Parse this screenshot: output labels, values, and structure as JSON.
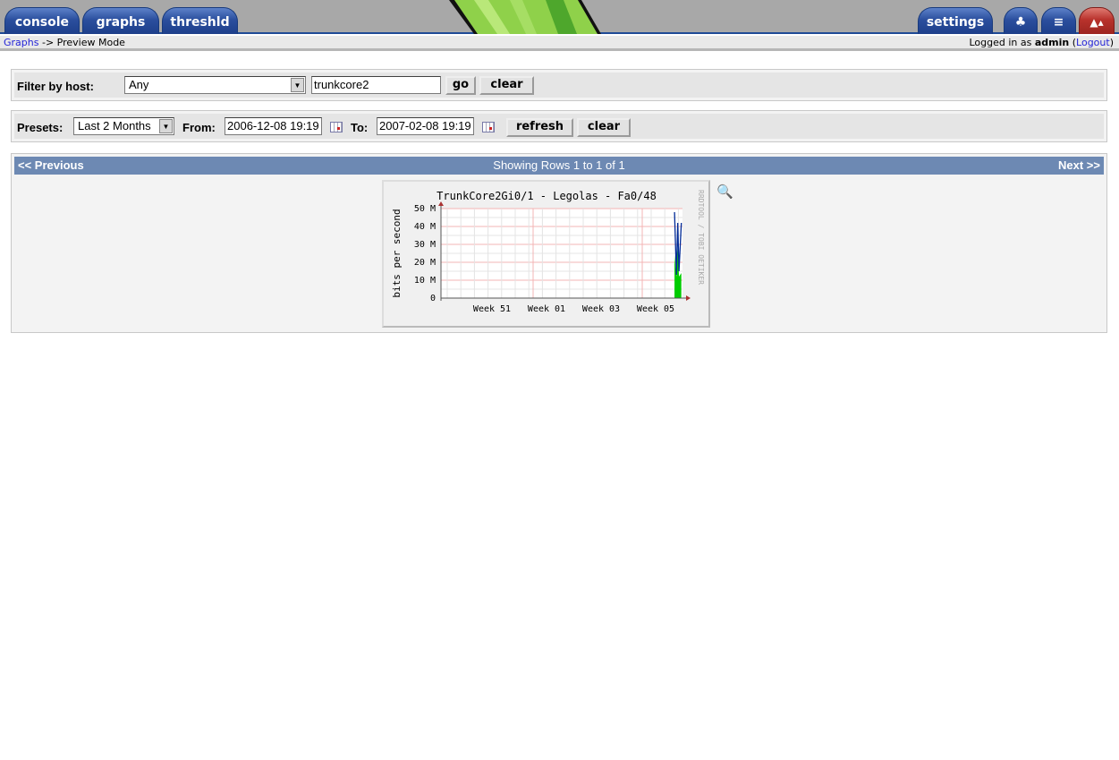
{
  "nav": {
    "tabs_left": [
      "console",
      "graphs",
      "threshld"
    ],
    "tabs_right": [
      "settings"
    ],
    "icon_tabs": [
      "tree-view-icon",
      "list-view-icon",
      "preview-mode-icon"
    ]
  },
  "breadcrumb": {
    "link": "Graphs",
    "rest": "-> Preview Mode"
  },
  "login": {
    "prefix": "Logged in as",
    "user": "admin",
    "logout": "Logout"
  },
  "filter": {
    "label": "Filter by host:",
    "host_value": "Any",
    "search_value": "trunkcore2",
    "go": "go",
    "clear": "clear"
  },
  "timespan": {
    "presets_label": "Presets:",
    "preset_value": "Last 2 Months",
    "from_label": "From:",
    "from_value": "2006-12-08 19:19",
    "to_label": "To:",
    "to_value": "2007-02-08 19:19",
    "refresh": "refresh",
    "clear": "clear"
  },
  "pager": {
    "previous": "<< Previous",
    "status": "Showing Rows 1 to 1 of 1",
    "next": "Next >>"
  },
  "chart_data": {
    "type": "area",
    "title": "TrunkCore2Gi0/1 - Legolas - Fa0/48",
    "ylabel": "bits per second",
    "watermark": "RRDTOOL / TOBI OETIKER",
    "yticks": [
      "0",
      "10 M",
      "20 M",
      "30 M",
      "40 M",
      "50 M"
    ],
    "ylim": [
      0,
      50
    ],
    "xticks": [
      "Week 51",
      "Week 01",
      "Week 03",
      "Week 05"
    ],
    "xlim": [
      "2006-12-08 19:19",
      "2007-02-08 19:19"
    ],
    "grid": true,
    "series": [
      {
        "kind": "area",
        "color": "#00cc00",
        "points": [
          [
            "2007-02-06 18:00",
            24
          ],
          [
            "2007-02-07 06:00",
            12
          ],
          [
            "2007-02-07 14:00",
            28
          ],
          [
            "2007-02-07 22:00",
            12
          ],
          [
            "2007-02-08 12:00",
            14
          ]
        ]
      },
      {
        "kind": "line",
        "color": "#002a97",
        "points": [
          [
            "2007-02-06 18:00",
            48
          ],
          [
            "2007-02-07 06:00",
            13
          ],
          [
            "2007-02-07 14:00",
            42
          ],
          [
            "2007-02-07 22:00",
            15
          ],
          [
            "2007-02-08 12:00",
            42
          ]
        ]
      }
    ]
  },
  "colors": {
    "tab_blue": "#2b4f9e",
    "tab_red": "#b8322c",
    "pager_bar": "#6d89b3"
  }
}
